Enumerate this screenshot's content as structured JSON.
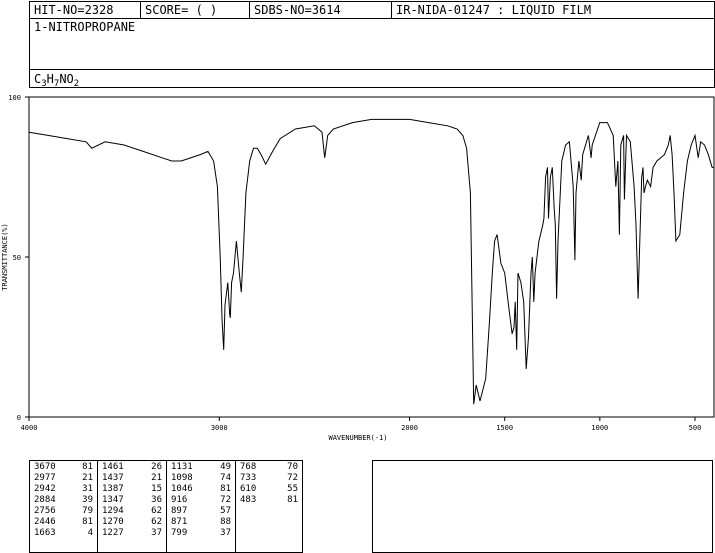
{
  "header": {
    "hit_no": "HIT-NO=2328",
    "score": "SCORE=  (   )",
    "sdbs_no": "SDBS-NO=3614",
    "ir_id": "IR-NIDA-01247 : LIQUID FILM"
  },
  "compound": {
    "name": "1-NITROPROPANE",
    "formula_parts": [
      {
        "t": "C",
        "sub": false
      },
      {
        "t": "3",
        "sub": true
      },
      {
        "t": "H",
        "sub": false
      },
      {
        "t": "7",
        "sub": true
      },
      {
        "t": "NO",
        "sub": false
      },
      {
        "t": "2",
        "sub": true
      }
    ]
  },
  "chart_data": {
    "type": "line",
    "xlabel": "WAVENUMBER(-1)",
    "ylabel": "TRANSMITTANCE(%)",
    "xlim": [
      4000,
      400
    ],
    "ylim": [
      0,
      100
    ],
    "x_ticks": [
      "4000",
      "3000",
      "2000",
      "1500",
      "1000",
      "500"
    ],
    "y_ticks": [
      "100",
      "50",
      "0"
    ],
    "series": [
      {
        "x": [
          4000,
          3900,
          3800,
          3700,
          3670,
          3600,
          3500,
          3400,
          3300,
          3250,
          3200,
          3100,
          3060,
          3030,
          3010,
          2995,
          2985,
          2977,
          2970,
          2955,
          2945,
          2942,
          2935,
          2925,
          2910,
          2895,
          2884,
          2875,
          2860,
          2840,
          2820,
          2800,
          2780,
          2756,
          2720,
          2680,
          2600,
          2500,
          2460,
          2446,
          2430,
          2400,
          2300,
          2200,
          2000,
          1900,
          1800,
          1750,
          1720,
          1700,
          1680,
          1663,
          1650,
          1630,
          1600,
          1580,
          1565,
          1553,
          1540,
          1520,
          1500,
          1480,
          1461,
          1451,
          1445,
          1437,
          1430,
          1415,
          1400,
          1387,
          1375,
          1362,
          1355,
          1347,
          1340,
          1320,
          1300,
          1294,
          1285,
          1275,
          1270,
          1260,
          1250,
          1240,
          1234,
          1227,
          1220,
          1200,
          1180,
          1160,
          1140,
          1131,
          1125,
          1110,
          1098,
          1090,
          1060,
          1046,
          1040,
          1000,
          960,
          930,
          916,
          905,
          897,
          890,
          875,
          871,
          860,
          840,
          820,
          810,
          799,
          790,
          780,
          773,
          768,
          760,
          750,
          733,
          720,
          700,
          660,
          640,
          630,
          620,
          610,
          600,
          580,
          560,
          540,
          520,
          500,
          483,
          470,
          450,
          430,
          410,
          400
        ],
        "y": [
          89,
          88,
          87,
          86,
          84,
          86,
          85,
          83,
          81,
          80,
          80,
          82,
          83,
          80,
          72,
          50,
          30,
          21,
          35,
          42,
          32,
          31,
          42,
          45,
          55,
          45,
          39,
          50,
          70,
          80,
          84,
          84,
          82,
          79,
          83,
          87,
          90,
          91,
          89,
          81,
          88,
          90,
          92,
          93,
          93,
          92,
          91,
          90,
          88,
          84,
          70,
          4,
          10,
          5,
          12,
          30,
          45,
          55,
          57,
          48,
          45,
          35,
          26,
          28,
          36,
          21,
          45,
          42,
          36,
          15,
          25,
          45,
          50,
          36,
          45,
          55,
          60,
          62,
          75,
          78,
          62,
          75,
          78,
          65,
          60,
          37,
          55,
          80,
          85,
          86,
          72,
          49,
          70,
          80,
          74,
          82,
          88,
          81,
          85,
          92,
          92,
          88,
          72,
          80,
          57,
          85,
          88,
          68,
          88,
          86,
          72,
          60,
          37,
          55,
          75,
          78,
          70,
          72,
          74,
          72,
          78,
          80,
          82,
          85,
          88,
          82,
          70,
          55,
          57,
          70,
          80,
          85,
          88,
          81,
          86,
          85,
          82,
          78,
          78
        ]
      }
    ],
    "peaks": [
      {
        "wn": "3670",
        "t": "81"
      },
      {
        "wn": "2977",
        "t": "21"
      },
      {
        "wn": "2942",
        "t": "31"
      },
      {
        "wn": "2884",
        "t": "39"
      },
      {
        "wn": "2756",
        "t": "79"
      },
      {
        "wn": "2446",
        "t": "81"
      },
      {
        "wn": "1663",
        "t": "4"
      },
      {
        "wn": "1461",
        "t": "26"
      },
      {
        "wn": "1437",
        "t": "21"
      },
      {
        "wn": "1387",
        "t": "15"
      },
      {
        "wn": "1347",
        "t": "36"
      },
      {
        "wn": "1294",
        "t": "62"
      },
      {
        "wn": "1270",
        "t": "62"
      },
      {
        "wn": "1227",
        "t": "37"
      },
      {
        "wn": "1131",
        "t": "49"
      },
      {
        "wn": "1098",
        "t": "74"
      },
      {
        "wn": "1046",
        "t": "81"
      },
      {
        "wn": "916",
        "t": "72"
      },
      {
        "wn": "897",
        "t": "57"
      },
      {
        "wn": "871",
        "t": "88"
      },
      {
        "wn": "799",
        "t": "37"
      },
      {
        "wn": "768",
        "t": "70"
      },
      {
        "wn": "733",
        "t": "72"
      },
      {
        "wn": "610",
        "t": "55"
      },
      {
        "wn": "483",
        "t": "81"
      }
    ]
  }
}
